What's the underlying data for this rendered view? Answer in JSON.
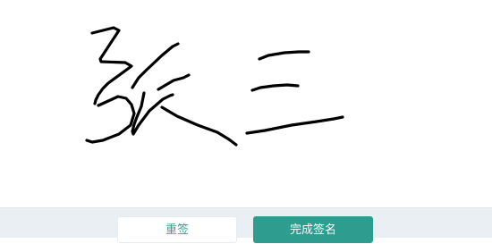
{
  "signature": {
    "ink_color": "#000000",
    "strokes_description_name": "signature-strokes"
  },
  "toolbar": {
    "reset_label": "重签",
    "done_label": "完成签名",
    "accent_color": "#2e9c8e"
  }
}
